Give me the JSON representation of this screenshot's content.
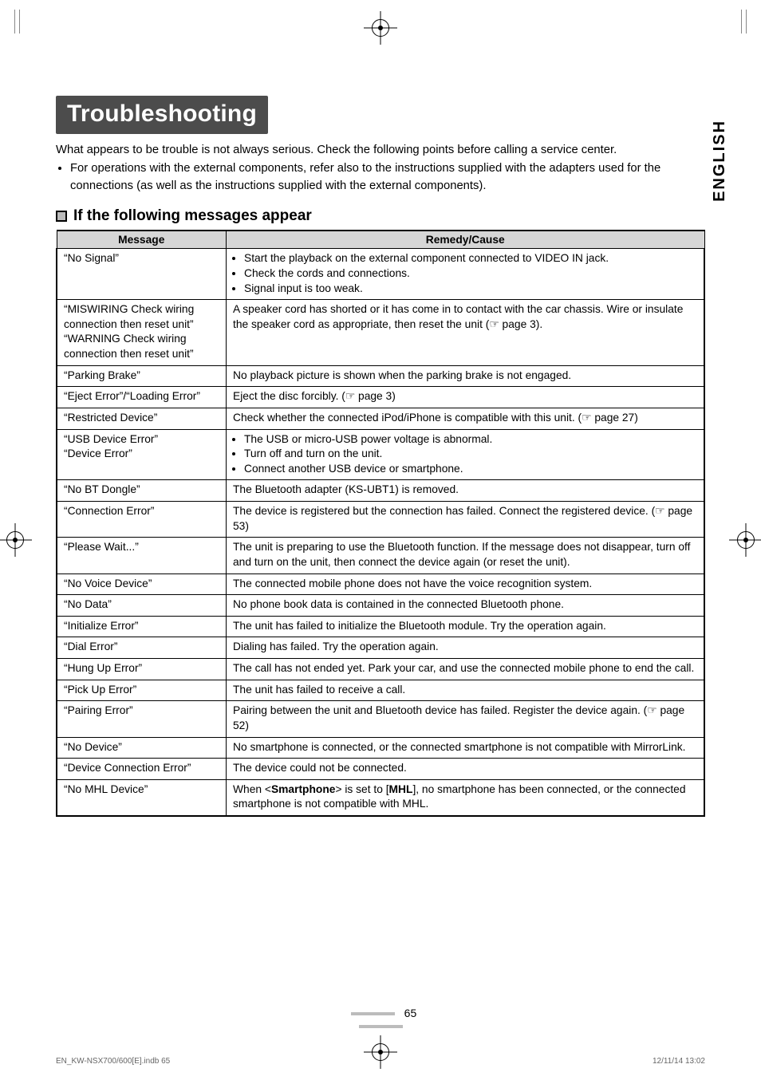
{
  "title": "Troubleshooting",
  "intro_line": "What appears to be trouble is not always serious. Check the following points before calling a service center.",
  "intro_bullet": "For operations with the external components, refer also to the instructions supplied with the adapters used for the connections (as well as the instructions supplied with the external components).",
  "section_heading": "If the following messages appear",
  "table": {
    "head_message": "Message",
    "head_remedy": "Remedy/Cause"
  },
  "rows": [
    {
      "msg": "“No Signal”",
      "remedy_list": [
        "Start the playback on the external component connected to VIDEO IN jack.",
        "Check the cords and connections.",
        "Signal input is too weak."
      ]
    },
    {
      "msg": "“MISWIRING Check wiring connection then reset unit”\n“WARNING Check wiring connection then reset unit”",
      "remedy": "A speaker cord has shorted or it has come in to contact with the car chassis. Wire or insulate the speaker cord as appropriate, then reset the unit (☞ page 3)."
    },
    {
      "msg": "“Parking Brake”",
      "remedy": "No playback picture is shown when the parking brake is not engaged."
    },
    {
      "msg": "“Eject Error”/“Loading Error”",
      "remedy": "Eject the disc forcibly. (☞ page 3)"
    },
    {
      "msg": "“Restricted Device”",
      "remedy": "Check whether the connected iPod/iPhone is compatible with this unit. (☞ page 27)"
    },
    {
      "msg": "“USB Device Error”\n“Device Error”",
      "remedy_list": [
        "The USB or micro-USB power voltage is abnormal.",
        "Turn off and turn on the unit.",
        "Connect another USB device or smartphone."
      ]
    },
    {
      "msg": "“No BT Dongle”",
      "remedy": "The Bluetooth adapter (KS-UBT1) is removed."
    },
    {
      "msg": "“Connection Error”",
      "remedy": "The device is registered but the connection has failed. Connect the registered device. (☞ page 53)"
    },
    {
      "msg": "“Please Wait...”",
      "remedy": "The unit is preparing to use the Bluetooth function. If the message does not disappear, turn off and turn on the unit, then connect the device again (or reset the unit)."
    },
    {
      "msg": "“No Voice Device”",
      "remedy": "The connected mobile phone does not have the voice recognition system."
    },
    {
      "msg": "“No Data”",
      "remedy": "No phone book data is contained in the connected Bluetooth phone."
    },
    {
      "msg": "“Initialize Error”",
      "remedy": "The unit has failed to initialize the Bluetooth module. Try the operation again."
    },
    {
      "msg": "“Dial Error”",
      "remedy": "Dialing has failed. Try the operation again."
    },
    {
      "msg": "“Hung Up Error”",
      "remedy": "The call has not ended yet. Park your car, and use the connected mobile phone to end the call."
    },
    {
      "msg": "“Pick Up Error”",
      "remedy": "The unit has failed to receive a call."
    },
    {
      "msg": "“Pairing Error”",
      "remedy": "Pairing between the unit and Bluetooth device has failed. Register the device again. (☞ page 52)"
    },
    {
      "msg": "“No Device”",
      "remedy": "No smartphone is connected, or the connected smartphone is not compatible with MirrorLink."
    },
    {
      "msg": "“Device Connection Error”",
      "remedy": "The device could not be connected."
    },
    {
      "msg": "“No MHL Device”",
      "remedy_html": "When &lt;<b>Smartphone</b>&gt; is set to [<b>MHL</b>], no smartphone has been connected, or the connected smartphone is not compatible with MHL."
    }
  ],
  "side_lang": "ENGLISH",
  "page_number": "65",
  "footer_left": "EN_KW-NSX700/600[E].indb   65",
  "footer_right": "12/11/14   13:02"
}
